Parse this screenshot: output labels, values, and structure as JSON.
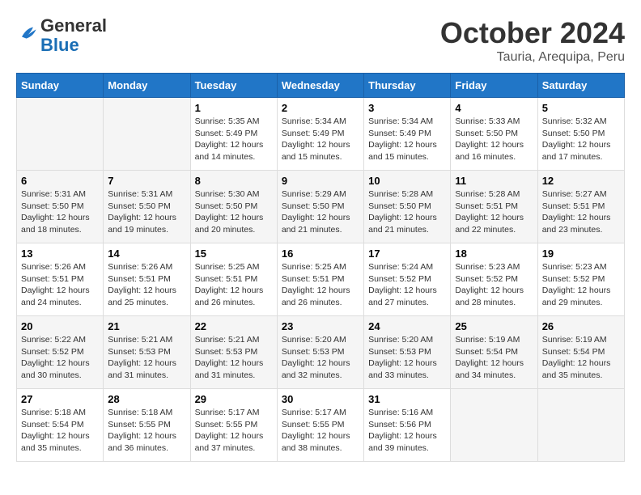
{
  "header": {
    "logo_line1": "General",
    "logo_line2": "Blue",
    "month": "October 2024",
    "location": "Tauria, Arequipa, Peru"
  },
  "weekdays": [
    "Sunday",
    "Monday",
    "Tuesday",
    "Wednesday",
    "Thursday",
    "Friday",
    "Saturday"
  ],
  "weeks": [
    [
      {
        "day": "",
        "sunrise": "",
        "sunset": "",
        "daylight": ""
      },
      {
        "day": "",
        "sunrise": "",
        "sunset": "",
        "daylight": ""
      },
      {
        "day": "1",
        "sunrise": "Sunrise: 5:35 AM",
        "sunset": "Sunset: 5:49 PM",
        "daylight": "Daylight: 12 hours and 14 minutes."
      },
      {
        "day": "2",
        "sunrise": "Sunrise: 5:34 AM",
        "sunset": "Sunset: 5:49 PM",
        "daylight": "Daylight: 12 hours and 15 minutes."
      },
      {
        "day": "3",
        "sunrise": "Sunrise: 5:34 AM",
        "sunset": "Sunset: 5:49 PM",
        "daylight": "Daylight: 12 hours and 15 minutes."
      },
      {
        "day": "4",
        "sunrise": "Sunrise: 5:33 AM",
        "sunset": "Sunset: 5:50 PM",
        "daylight": "Daylight: 12 hours and 16 minutes."
      },
      {
        "day": "5",
        "sunrise": "Sunrise: 5:32 AM",
        "sunset": "Sunset: 5:50 PM",
        "daylight": "Daylight: 12 hours and 17 minutes."
      }
    ],
    [
      {
        "day": "6",
        "sunrise": "Sunrise: 5:31 AM",
        "sunset": "Sunset: 5:50 PM",
        "daylight": "Daylight: 12 hours and 18 minutes."
      },
      {
        "day": "7",
        "sunrise": "Sunrise: 5:31 AM",
        "sunset": "Sunset: 5:50 PM",
        "daylight": "Daylight: 12 hours and 19 minutes."
      },
      {
        "day": "8",
        "sunrise": "Sunrise: 5:30 AM",
        "sunset": "Sunset: 5:50 PM",
        "daylight": "Daylight: 12 hours and 20 minutes."
      },
      {
        "day": "9",
        "sunrise": "Sunrise: 5:29 AM",
        "sunset": "Sunset: 5:50 PM",
        "daylight": "Daylight: 12 hours and 21 minutes."
      },
      {
        "day": "10",
        "sunrise": "Sunrise: 5:28 AM",
        "sunset": "Sunset: 5:50 PM",
        "daylight": "Daylight: 12 hours and 21 minutes."
      },
      {
        "day": "11",
        "sunrise": "Sunrise: 5:28 AM",
        "sunset": "Sunset: 5:51 PM",
        "daylight": "Daylight: 12 hours and 22 minutes."
      },
      {
        "day": "12",
        "sunrise": "Sunrise: 5:27 AM",
        "sunset": "Sunset: 5:51 PM",
        "daylight": "Daylight: 12 hours and 23 minutes."
      }
    ],
    [
      {
        "day": "13",
        "sunrise": "Sunrise: 5:26 AM",
        "sunset": "Sunset: 5:51 PM",
        "daylight": "Daylight: 12 hours and 24 minutes."
      },
      {
        "day": "14",
        "sunrise": "Sunrise: 5:26 AM",
        "sunset": "Sunset: 5:51 PM",
        "daylight": "Daylight: 12 hours and 25 minutes."
      },
      {
        "day": "15",
        "sunrise": "Sunrise: 5:25 AM",
        "sunset": "Sunset: 5:51 PM",
        "daylight": "Daylight: 12 hours and 26 minutes."
      },
      {
        "day": "16",
        "sunrise": "Sunrise: 5:25 AM",
        "sunset": "Sunset: 5:51 PM",
        "daylight": "Daylight: 12 hours and 26 minutes."
      },
      {
        "day": "17",
        "sunrise": "Sunrise: 5:24 AM",
        "sunset": "Sunset: 5:52 PM",
        "daylight": "Daylight: 12 hours and 27 minutes."
      },
      {
        "day": "18",
        "sunrise": "Sunrise: 5:23 AM",
        "sunset": "Sunset: 5:52 PM",
        "daylight": "Daylight: 12 hours and 28 minutes."
      },
      {
        "day": "19",
        "sunrise": "Sunrise: 5:23 AM",
        "sunset": "Sunset: 5:52 PM",
        "daylight": "Daylight: 12 hours and 29 minutes."
      }
    ],
    [
      {
        "day": "20",
        "sunrise": "Sunrise: 5:22 AM",
        "sunset": "Sunset: 5:52 PM",
        "daylight": "Daylight: 12 hours and 30 minutes."
      },
      {
        "day": "21",
        "sunrise": "Sunrise: 5:21 AM",
        "sunset": "Sunset: 5:53 PM",
        "daylight": "Daylight: 12 hours and 31 minutes."
      },
      {
        "day": "22",
        "sunrise": "Sunrise: 5:21 AM",
        "sunset": "Sunset: 5:53 PM",
        "daylight": "Daylight: 12 hours and 31 minutes."
      },
      {
        "day": "23",
        "sunrise": "Sunrise: 5:20 AM",
        "sunset": "Sunset: 5:53 PM",
        "daylight": "Daylight: 12 hours and 32 minutes."
      },
      {
        "day": "24",
        "sunrise": "Sunrise: 5:20 AM",
        "sunset": "Sunset: 5:53 PM",
        "daylight": "Daylight: 12 hours and 33 minutes."
      },
      {
        "day": "25",
        "sunrise": "Sunrise: 5:19 AM",
        "sunset": "Sunset: 5:54 PM",
        "daylight": "Daylight: 12 hours and 34 minutes."
      },
      {
        "day": "26",
        "sunrise": "Sunrise: 5:19 AM",
        "sunset": "Sunset: 5:54 PM",
        "daylight": "Daylight: 12 hours and 35 minutes."
      }
    ],
    [
      {
        "day": "27",
        "sunrise": "Sunrise: 5:18 AM",
        "sunset": "Sunset: 5:54 PM",
        "daylight": "Daylight: 12 hours and 35 minutes."
      },
      {
        "day": "28",
        "sunrise": "Sunrise: 5:18 AM",
        "sunset": "Sunset: 5:55 PM",
        "daylight": "Daylight: 12 hours and 36 minutes."
      },
      {
        "day": "29",
        "sunrise": "Sunrise: 5:17 AM",
        "sunset": "Sunset: 5:55 PM",
        "daylight": "Daylight: 12 hours and 37 minutes."
      },
      {
        "day": "30",
        "sunrise": "Sunrise: 5:17 AM",
        "sunset": "Sunset: 5:55 PM",
        "daylight": "Daylight: 12 hours and 38 minutes."
      },
      {
        "day": "31",
        "sunrise": "Sunrise: 5:16 AM",
        "sunset": "Sunset: 5:56 PM",
        "daylight": "Daylight: 12 hours and 39 minutes."
      },
      {
        "day": "",
        "sunrise": "",
        "sunset": "",
        "daylight": ""
      },
      {
        "day": "",
        "sunrise": "",
        "sunset": "",
        "daylight": ""
      }
    ]
  ]
}
